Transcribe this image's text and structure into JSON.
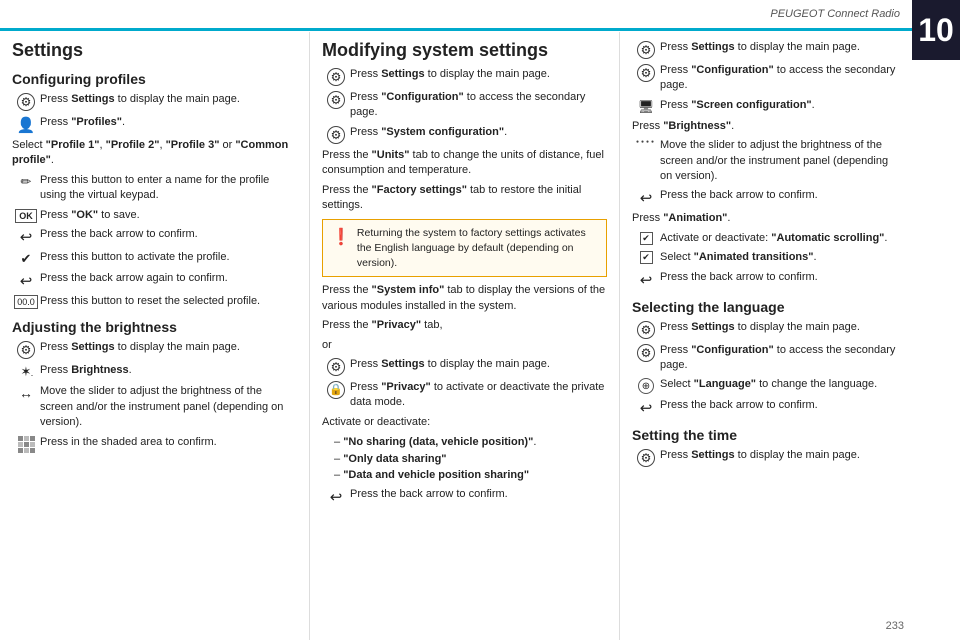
{
  "header": {
    "title": "PEUGEOT Connect Radio",
    "chapter": "10"
  },
  "page_number": "233",
  "left_col": {
    "section_title": "Settings",
    "configuring_title": "Configuring profiles",
    "config_steps": [
      {
        "icon": "gear",
        "text": "Press <b>Settings</b> to display the main page."
      },
      {
        "icon": "profile",
        "text": "Press <b>\"Profiles\"</b>."
      }
    ],
    "select_text": "Select <b>\"Profile 1\"</b>, <b>\"Profile 2\"</b>, <b>\"Profile 3\"</b> or <b>\"Common profile\"</b>.",
    "profile_steps": [
      {
        "icon": "pencil",
        "text": "Press this button to enter a name for the profile using the virtual keypad."
      },
      {
        "icon": "ok",
        "text": "Press <b>\"OK\"</b> to save."
      },
      {
        "icon": "back",
        "text": "Press the back arrow to confirm."
      },
      {
        "icon": "check",
        "text": "Press this button to activate the profile."
      },
      {
        "icon": "back",
        "text": "Press the back arrow again to confirm."
      },
      {
        "icon": "reset",
        "text": "Press this button to reset the selected profile."
      }
    ],
    "adjusting_title": "Adjusting the brightness",
    "brightness_steps": [
      {
        "icon": "gear",
        "text": "Press <b>Settings</b> to display the main page."
      },
      {
        "icon": "sun",
        "text": "Press <b>Brightness</b>."
      },
      {
        "icon": "slider",
        "text": "Move the slider to adjust the brightness of the screen and/or the instrument panel (depending on version)."
      },
      {
        "icon": "grid",
        "text": "Press in the shaded area to confirm."
      }
    ]
  },
  "middle_col": {
    "section_title": "Modifying system settings",
    "mod_steps_1": [
      {
        "icon": "gear",
        "text": "Press <b>Settings</b> to display the main page."
      },
      {
        "icon": "gear",
        "text": "Press <b>\"Configuration\"</b> to access the secondary page."
      },
      {
        "icon": "gear",
        "text": "Press <b>\"System configuration\"</b>."
      }
    ],
    "para1": "Press the <b>\"Units\"</b> tab to change the units of distance, fuel consumption and temperature.",
    "para2": "Press the <b>\"Factory settings\"</b> tab to restore the initial settings.",
    "warning": "Returning the system to factory settings activates the English language by default (depending on version).",
    "para3": "Press the <b>\"System info\"</b> tab to display the versions of the various modules installed in the system.",
    "para4": "Press the <b>\"Privacy\"</b> tab,",
    "para4b": "or",
    "privacy_steps": [
      {
        "icon": "gear",
        "text": "Press <b>Settings</b> to display the main page."
      },
      {
        "icon": "lock",
        "text": "Press <b>\"Privacy\"</b> to activate or deactivate the private data mode."
      }
    ],
    "activate_text": "Activate or deactivate:",
    "privacy_bullets": [
      "\"No sharing (data, vehicle position)\".",
      "\"Only data sharing\"",
      "\"Data and vehicle position sharing\""
    ],
    "confirm_step": {
      "icon": "back",
      "text": "Press the back arrow to confirm."
    }
  },
  "right_col": {
    "screen_config_steps": [
      {
        "icon": "gear",
        "text": "Press <b>Settings</b> to display the main page."
      },
      {
        "icon": "gear2",
        "text": "Press <b>\"Configuration\"</b> to access the secondary page."
      },
      {
        "icon": "screen",
        "text": "Press <b>\"Screen configuration\"</b>."
      }
    ],
    "brightness_label": "Press <b>\"Brightness\"</b>.",
    "brightness_desc": "Move the slider to adjust the brightness of the screen and/or the instrument panel (depending on version).",
    "back_confirm": "Press the back arrow to confirm.",
    "animation_label": "Press <b>\"Animation\"</b>.",
    "animation_steps": [
      {
        "icon": "checkbox",
        "text": "Activate or deactivate: <b>\"Automatic scrolling\"</b>."
      },
      {
        "icon": "checkbox",
        "text": "Select <b>\"Animated transitions\"</b>."
      },
      {
        "icon": "back",
        "text": "Press the back arrow to confirm."
      }
    ],
    "selecting_title": "Selecting the language",
    "language_steps": [
      {
        "icon": "gear",
        "text": "Press <b>Settings</b> to display the main page."
      },
      {
        "icon": "gear2",
        "text": "Press <b>\"Configuration\"</b> to access the secondary page."
      },
      {
        "icon": "lang",
        "text": "Select <b>\"Language\"</b> to change the language."
      },
      {
        "icon": "back",
        "text": "Press the back arrow to confirm."
      }
    ],
    "setting_time_title": "Setting the time",
    "time_steps": [
      {
        "icon": "gear",
        "text": "Press <b>Settings</b> to display the main page."
      }
    ]
  }
}
